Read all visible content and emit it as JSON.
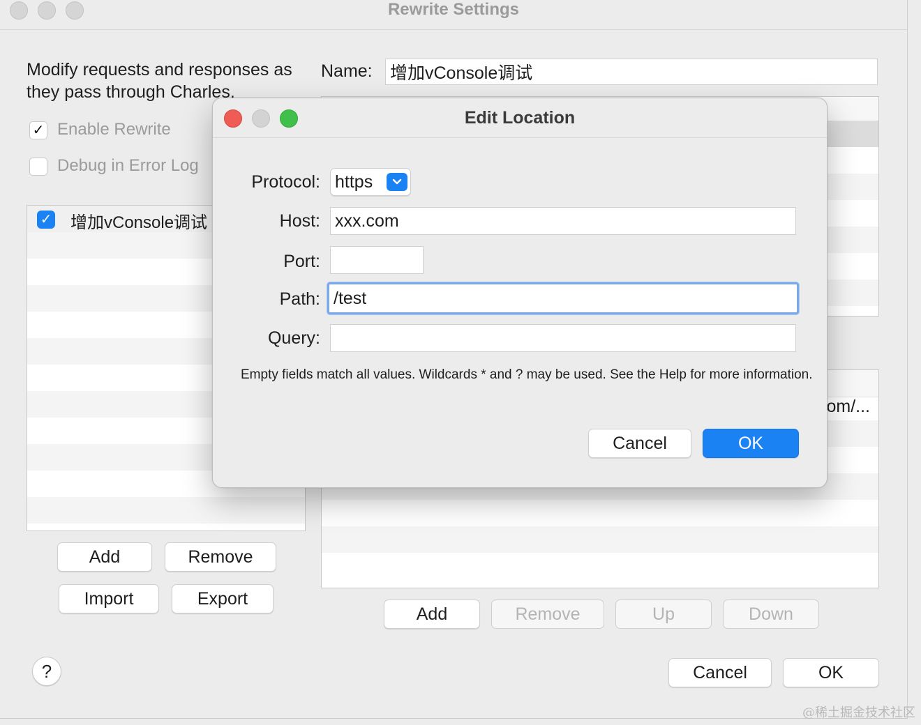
{
  "window": {
    "title": "Rewrite Settings"
  },
  "left": {
    "description": "Modify requests and responses as they pass through Charles.",
    "enable_rewrite": {
      "label": "Enable Rewrite",
      "checked": true
    },
    "debug_error_log": {
      "label": "Debug in Error Log",
      "checked": false
    },
    "sets": [
      {
        "label": "增加vConsole调试",
        "checked": true
      }
    ],
    "buttons": {
      "add": "Add",
      "remove": "Remove",
      "import": "Import",
      "export": "Export"
    }
  },
  "right": {
    "name_label": "Name:",
    "name_value": "增加vConsole调试",
    "rules_truncated_text": "om/...",
    "buttons": {
      "add": "Add",
      "remove": "Remove",
      "up": "Up",
      "down": "Down"
    }
  },
  "footer": {
    "help": "?",
    "cancel": "Cancel",
    "ok": "OK"
  },
  "dialog": {
    "title": "Edit Location",
    "protocol_label": "Protocol:",
    "protocol_value": "https",
    "host_label": "Host:",
    "host_value": "xxx.com",
    "port_label": "Port:",
    "port_value": "",
    "path_label": "Path:",
    "path_value": "/test",
    "query_label": "Query:",
    "query_value": "",
    "note": "Empty fields match all values. Wildcards * and ? may be used. See the Help for more information.",
    "cancel": "Cancel",
    "ok": "OK"
  },
  "watermark": "@稀土掘金技术社区",
  "colors": {
    "accent": "#1b82f4",
    "close": "#ee5c55",
    "zoom": "#40c04a"
  }
}
